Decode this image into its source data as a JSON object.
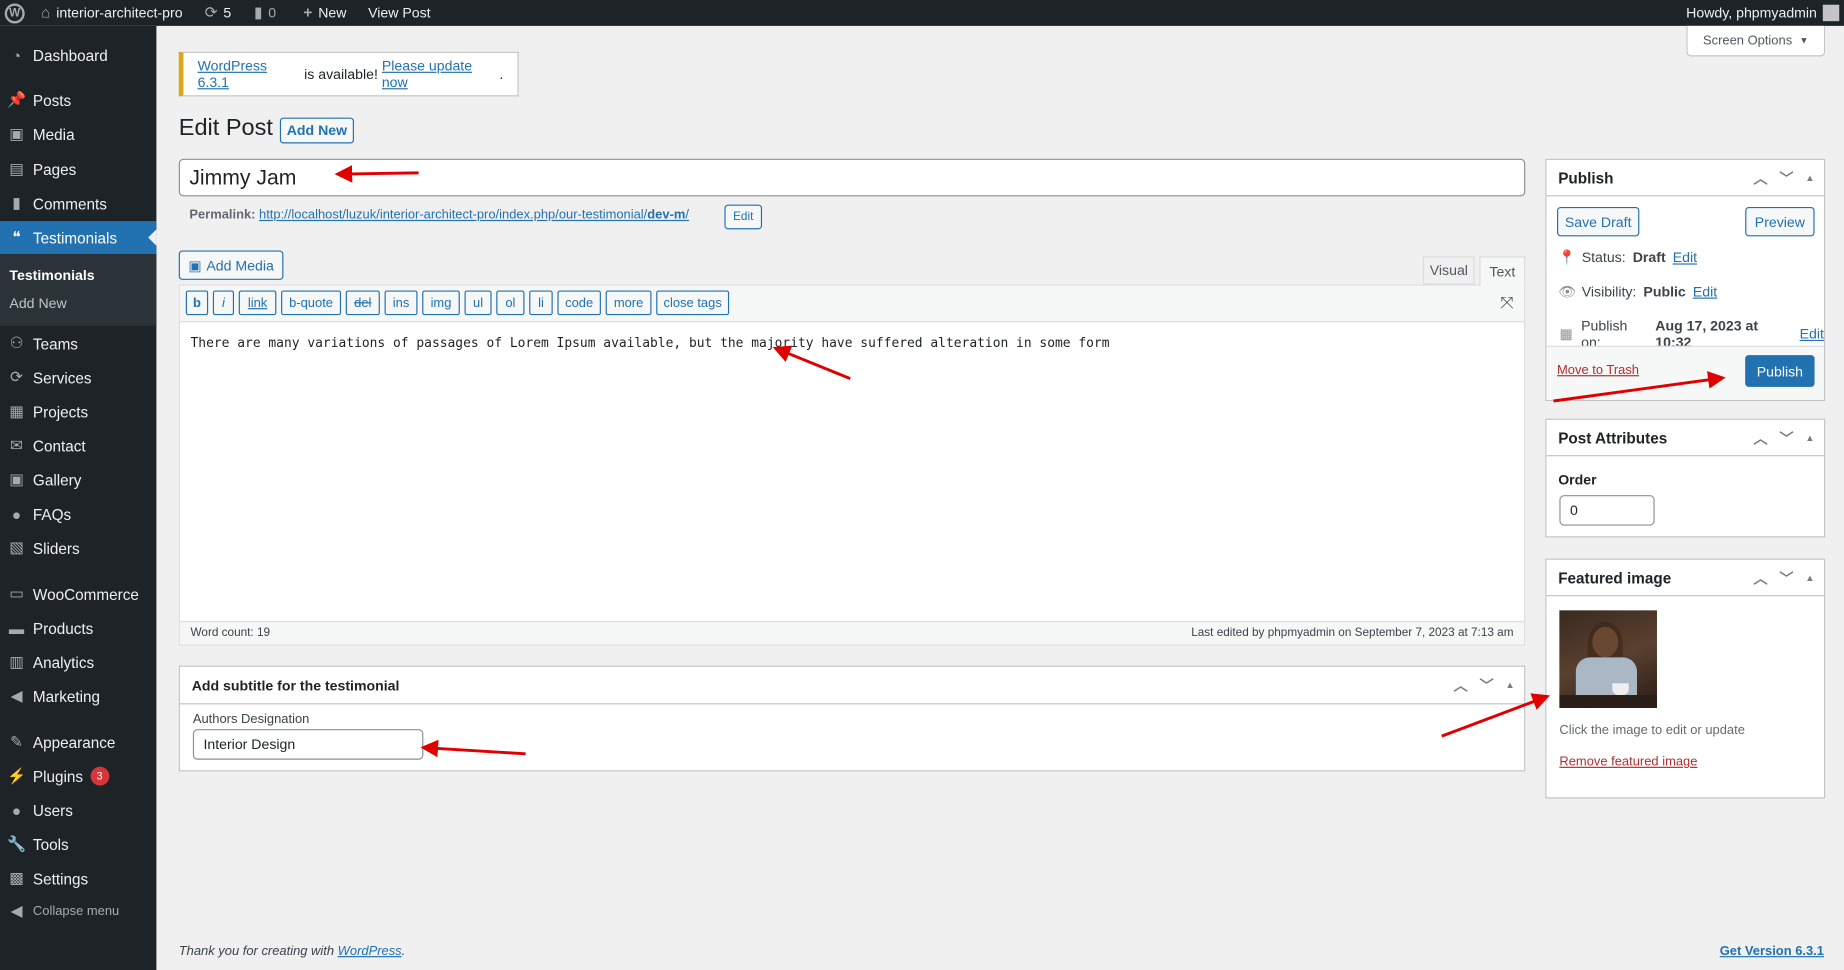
{
  "adminbar": {
    "site": "interior-architect-pro",
    "updates": "5",
    "comments": "0",
    "new": "New",
    "view_post": "View Post",
    "howdy": "Howdy, phpmyadmin"
  },
  "sidebar": {
    "items": [
      {
        "label": "Dashboard",
        "icon": "dashboard-icon"
      },
      {
        "label": "Posts",
        "icon": "pin-icon"
      },
      {
        "label": "Media",
        "icon": "media-icon"
      },
      {
        "label": "Pages",
        "icon": "pages-icon"
      },
      {
        "label": "Comments",
        "icon": "comment-icon"
      },
      {
        "label": "Testimonials",
        "icon": "testimonial-icon"
      },
      {
        "label": "Teams",
        "icon": "groups-icon"
      },
      {
        "label": "Services",
        "icon": "update-icon"
      },
      {
        "label": "Projects",
        "icon": "grid-icon"
      },
      {
        "label": "Contact",
        "icon": "email-icon"
      },
      {
        "label": "Gallery",
        "icon": "media-icon"
      },
      {
        "label": "FAQs",
        "icon": "chat-icon"
      },
      {
        "label": "Sliders",
        "icon": "slides-icon"
      },
      {
        "label": "WooCommerce",
        "icon": "woo-icon"
      },
      {
        "label": "Products",
        "icon": "archive-icon"
      },
      {
        "label": "Analytics",
        "icon": "chart-icon"
      },
      {
        "label": "Marketing",
        "icon": "megaphone-icon"
      },
      {
        "label": "Appearance",
        "icon": "brush-icon"
      },
      {
        "label": "Plugins",
        "icon": "plugin-icon",
        "badge": "3"
      },
      {
        "label": "Users",
        "icon": "user-icon"
      },
      {
        "label": "Tools",
        "icon": "wrench-icon"
      },
      {
        "label": "Settings",
        "icon": "settings-icon"
      }
    ],
    "submenu": [
      "Testimonials",
      "Add New"
    ],
    "collapse": "Collapse menu"
  },
  "notice": {
    "version_link": "WordPress 6.3.1",
    "middle": " is available! ",
    "update_link": "Please update now",
    "end": "."
  },
  "screen_options": "Screen Options",
  "page": {
    "title": "Edit Post",
    "add_new": "Add New"
  },
  "post": {
    "title": "Jimmy Jam",
    "permalink_label": "Permalink:",
    "permalink_base": "http://localhost/luzuk/interior-architect-pro/index.php/our-testimonial/",
    "permalink_slug": "dev-m",
    "permalink_end": "/",
    "edit": "Edit"
  },
  "editor": {
    "add_media": "Add Media",
    "tabs": [
      "Visual",
      "Text"
    ],
    "active_tab": "Text",
    "quicktags": [
      "b",
      "i",
      "link",
      "b-quote",
      "del",
      "ins",
      "img",
      "ul",
      "ol",
      "li",
      "code",
      "more",
      "close tags"
    ],
    "content": "There are many variations of passages of Lorem Ipsum available, but the majority have suffered alteration in some form",
    "word_count": "Word count: 19",
    "last_edited": "Last edited by phpmyadmin on September 7, 2023 at 7:13 am"
  },
  "subtitle_box": {
    "title": "Add subtitle for the testimonial",
    "label": "Authors Designation",
    "value": "Interior Design"
  },
  "publish": {
    "title": "Publish",
    "save_draft": "Save Draft",
    "preview": "Preview",
    "status_label": "Status:",
    "status": "Draft",
    "visibility_label": "Visibility:",
    "visibility": "Public",
    "publish_on_label": "Publish on:",
    "publish_on": "Aug 17, 2023 at 10:32",
    "edit": "Edit",
    "trash": "Move to Trash",
    "publish_btn": "Publish"
  },
  "attributes": {
    "title": "Post Attributes",
    "order_label": "Order",
    "order": "0"
  },
  "featured": {
    "title": "Featured image",
    "hint": "Click the image to edit or update",
    "remove": "Remove featured image"
  },
  "footer": {
    "thanks": "Thank you for creating with ",
    "wp": "WordPress",
    "period": ".",
    "version": "Get Version 6.3.1"
  },
  "colors": {
    "accent": "#2271b1",
    "adminbar": "#1d2327",
    "annotation": "#e00000",
    "trash": "#b32d2e"
  }
}
